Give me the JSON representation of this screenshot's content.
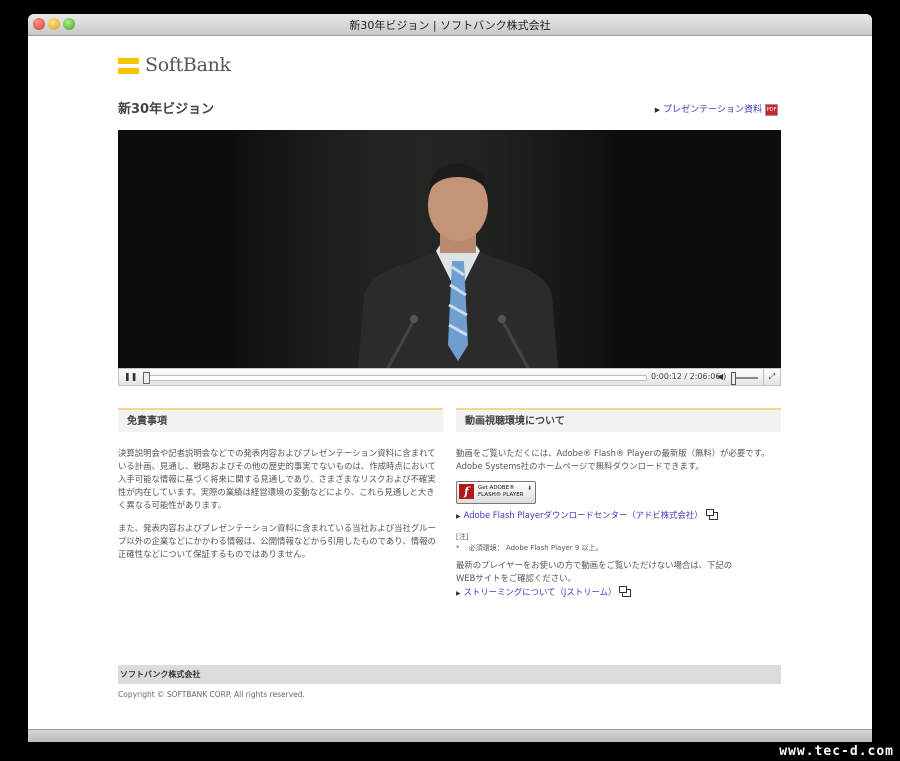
{
  "window": {
    "title": "新30年ビジョン | ソフトバンク株式会社"
  },
  "logo": {
    "text": "SoftBank",
    "bar_color": "#f5c400"
  },
  "page": {
    "title": "新30年ビジョン",
    "presentation_link": "プレゼンテーション資料",
    "pdf_icon_label": "PDF"
  },
  "player": {
    "current_time": "0:00:12",
    "duration": "2:06:06",
    "time_separator": " / ",
    "progress_fraction": 0.0016
  },
  "disclaimer": {
    "heading": "免責事項",
    "paragraph1": "決算説明会や記者説明会などでの発表内容およびプレゼンテーション資料に含まれている計画、見通し、戦略およびその他の歴史的事実でないものは、作成時点において入手可能な情報に基づく将来に関する見通しであり、さまざまなリスクおよび不確実性が内在しています。実際の業績は経営環境の変動などにより、これら見通しと大きく異なる可能性があります。",
    "paragraph2": "また、発表内容およびプレゼンテーション資料に含まれている当社および当社グループ以外の企業などにかかわる情報は、公開情報などから引用したものであり、情報の正確性などについて保証するものではありません。"
  },
  "environment": {
    "heading": "動画視聴環境について",
    "paragraph": "動画をご覧いただくには、Adobe® Flash® Playerの最新版（無料）が必要です。Adobe Systems社のホームページで無料ダウンロードできます。",
    "flash_badge_line1": "Get ADOBE®",
    "flash_badge_line2": "FLASH® PLAYER",
    "flash_link": "Adobe Flash Playerダウンロードセンター（アドビ株式会社）",
    "note_label": "[注]",
    "note_text": "*　 必須環境： Adobe Flash Player 9 以上。",
    "alt_paragraph": "最新のプレイヤーをお使いの方で動画をご覧いただけない場合は、下記のWEBサイトをご確認ください。",
    "streaming_link": "ストリーミングについて（Jストリーム）"
  },
  "footer": {
    "company": "ソフトバンク株式会社",
    "copyright": "Copyright © SOFTBANK CORP. All rights reserved."
  },
  "watermark": "www.tec-d.com"
}
